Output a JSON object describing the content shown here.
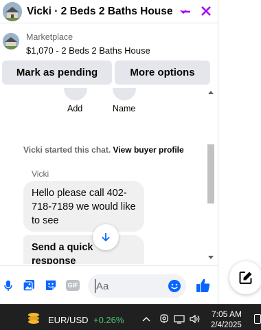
{
  "header": {
    "title": "Vicki · 2 Beds 2 Baths House",
    "chevron_icon": "chevron-down-icon",
    "minimize_icon": "minimize-icon",
    "close_icon": "close-icon"
  },
  "context": {
    "label": "Marketplace",
    "listing": "$1,070 - 2 Beds 2 Baths House"
  },
  "actions": {
    "mark_pending": "Mark as pending",
    "more_options": "More options"
  },
  "quick_actions": [
    {
      "label": "Add",
      "icon": "add-icon"
    },
    {
      "label": "Name",
      "icon": "name-icon"
    }
  ],
  "chat": {
    "started_text": "Vicki started this chat.",
    "profile_link": "View buyer profile",
    "sender": "Vicki",
    "messages": [
      {
        "text": "Hello please call 402-718-7189 we would like to see"
      },
      {
        "text": "Send a quick response"
      }
    ]
  },
  "composer": {
    "placeholder": "Aa",
    "icons": [
      "microphone-icon",
      "photo-icon",
      "sticker-icon",
      "gif-icon",
      "emoji-icon",
      "like-icon"
    ],
    "gif_label": "GIF"
  },
  "taskbar": {
    "ticker_pair": "EUR/USD",
    "ticker_change": "+0.26%",
    "time": "7:05 AM",
    "date": "2/4/2025"
  },
  "colors": {
    "accent": "#0866ff",
    "close_purple": "#a100ff",
    "bubble": "#f0f0f0",
    "ticker_green": "#4cc76c"
  }
}
